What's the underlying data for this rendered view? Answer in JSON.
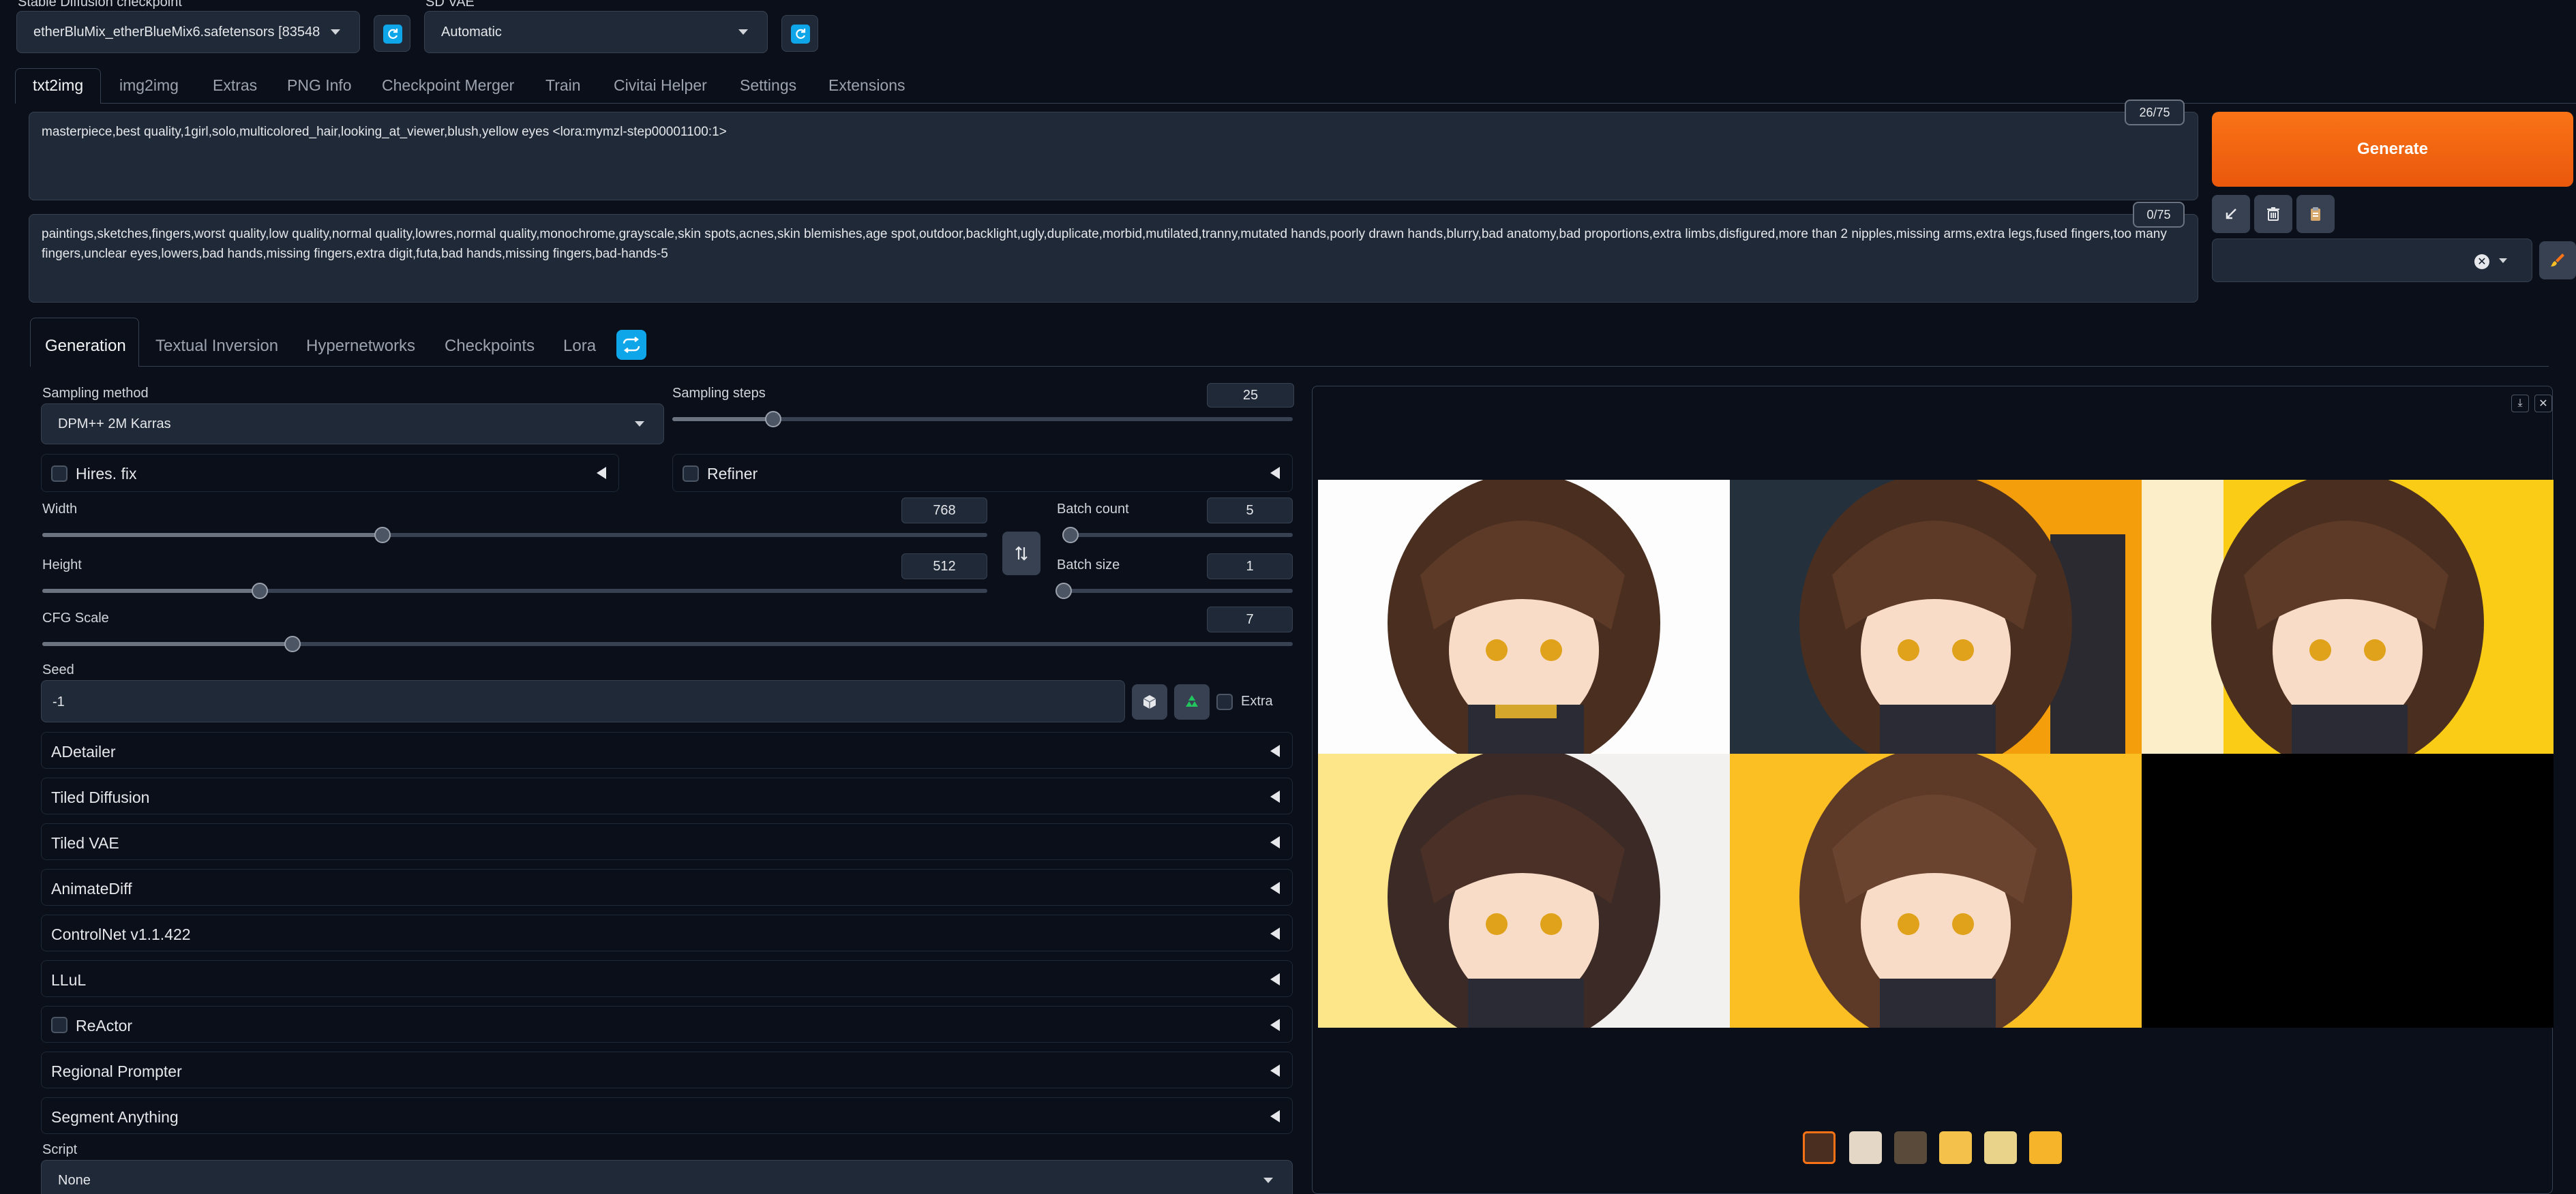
{
  "top": {
    "checkpoint_label": "Stable Diffusion checkpoint",
    "checkpoint_value": "etherBluMix_etherBlueMix6.safetensors [83548",
    "vae_label": "SD VAE",
    "vae_value": "Automatic"
  },
  "tabs": [
    "txt2img",
    "img2img",
    "Extras",
    "PNG Info",
    "Checkpoint Merger",
    "Train",
    "Civitai Helper",
    "Settings",
    "Extensions"
  ],
  "prompt": {
    "positive": "masterpiece,best quality,1girl,solo,multicolored_hair,looking_at_viewer,blush,yellow eyes <lora:mymzl-step00001100:1>",
    "positive_count": "26/75",
    "negative": "paintings,sketches,fingers,worst quality,low quality,normal quality,lowres,normal quality,monochrome,grayscale,skin spots,acnes,skin blemishes,age spot,outdoor,backlight,ugly,duplicate,morbid,mutilated,tranny,mutated hands,poorly drawn hands,blurry,bad anatomy,bad proportions,extra limbs,disfigured,more than 2 nipples,missing arms,extra legs,fused fingers,too many fingers,unclear eyes,lowers,bad hands,missing fingers,extra digit,futa,bad hands,missing fingers,bad-hands-5",
    "negative_count": "0/75"
  },
  "generate_label": "Generate",
  "subtabs": [
    "Generation",
    "Textual Inversion",
    "Hypernetworks",
    "Checkpoints",
    "Lora"
  ],
  "generation": {
    "sampling_method_label": "Sampling method",
    "sampling_method_value": "DPM++ 2M Karras",
    "sampling_steps_label": "Sampling steps",
    "sampling_steps": "25",
    "sampling_steps_frac": 0.163,
    "hires_label": "Hires. fix",
    "refiner_label": "Refiner",
    "width_label": "Width",
    "width": "768",
    "width_frac": 0.36,
    "height_label": "Height",
    "height": "512",
    "height_frac": 0.23,
    "batch_count_label": "Batch count",
    "batch_count": "5",
    "batch_count_frac": 0.03,
    "batch_size_label": "Batch size",
    "batch_size": "1",
    "batch_size_frac": 0.0,
    "cfg_label": "CFG Scale",
    "cfg": "7",
    "cfg_frac": 0.2,
    "seed_label": "Seed",
    "seed": "-1",
    "extra_label": "Extra"
  },
  "accordions": [
    "ADetailer",
    "Tiled Diffusion",
    "Tiled VAE",
    "AnimateDiff",
    "ControlNet v1.1.422",
    "LLuL",
    "ReActor",
    "Regional Prompter",
    "Segment Anything"
  ],
  "script_label": "Script",
  "script_value": "None",
  "colors": {
    "generate": "#f97316",
    "accent": "#0ea5e9",
    "background": "#0b0f19"
  },
  "gallery": {
    "thumbnails": 6,
    "selected": 0
  }
}
